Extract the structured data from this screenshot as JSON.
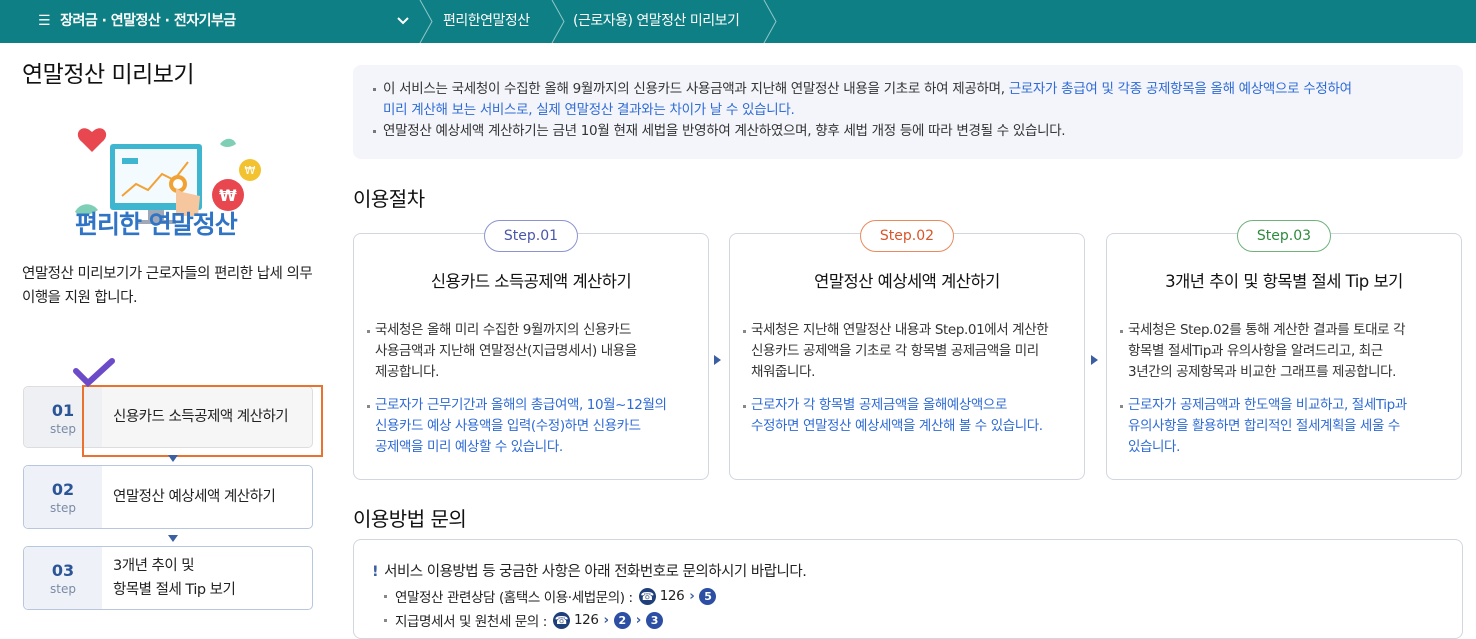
{
  "topbar": {
    "menu_icon": "hamburger-icon",
    "menu_label": "장려금 · 연말정산 · 전자기부금",
    "breadcrumb": [
      "편리한연말정산",
      "(근로자용) 연말정산 미리보기"
    ]
  },
  "sidebar": {
    "title": "연말정산 미리보기",
    "brand": "편리한 연말정산",
    "description": "연말정산 미리보기가 근로자들의  편리한 납세 의무 이행을 지원 합니다.",
    "steps": [
      {
        "num": "01",
        "sub": "step",
        "label": "신용카드 소득공제액 계산하기"
      },
      {
        "num": "02",
        "sub": "step",
        "label": "연말정산 예상세액 계산하기"
      },
      {
        "num": "03",
        "sub": "step",
        "label_line1": "3개년 추이 및",
        "label_line2": "항목별 절세 Tip 보기"
      }
    ]
  },
  "notice": {
    "line1_a": "이 서비스는 국세청이 수집한 올해 9월까지의 신용카드 사용금액과 지난해 연말정산 내용을 기초로 하여 제공하며, ",
    "line1_b": "근로자가 총급여 및 각종 공제항목을 올해 예상액으로 수정하여",
    "line1_c": "미리 계산해 보는 서비스로, 실제 연말정산 결과와는 차이가 날 수 있습니다.",
    "line2": "연말정산 예상세액 계산하기는 금년 10월 현재 세법을 반영하여 계산하였으며, 향후 세법 개정 등에 따라 변경될 수 있습니다."
  },
  "procedure": {
    "heading": "이용절차",
    "cards": [
      {
        "step": "Step.01",
        "title": "신용카드 소득공제액 계산하기",
        "body": [
          "국세청은 올해 미리 수집한 9월까지의 신용카드",
          "사용금액과 지난해 연말정산(지급명세서) 내용을",
          "제공합니다."
        ],
        "note": [
          "근로자가 근무기간과 올해의 총급여액, 10월~12월의",
          "신용카드 예상 사용액을 입력(수정)하면 신용카드",
          "공제액을 미리 예상할 수 있습니다."
        ]
      },
      {
        "step": "Step.02",
        "title": "연말정산 예상세액 계산하기",
        "body": [
          "국세청은 지난해 연말정산 내용과 Step.01에서 계산한",
          "신용카드 공제액을 기초로 각 항목별 공제금액을 미리",
          "채워줍니다."
        ],
        "note": [
          "근로자가 각 항목별 공제금액을 올해예상액으로",
          "수정하면 연말정산 예상세액을 계산해 볼 수 있습니다."
        ]
      },
      {
        "step": "Step.03",
        "title": "3개년 추이 및 항목별 절세 Tip 보기",
        "body": [
          "국세청은 Step.02를 통해 계산한 결과를 토대로 각",
          "항목별 절세Tip과 유의사항을 알려드리고, 최근",
          "3년간의 공제항목과 비교한 그래프를 제공합니다."
        ],
        "note": [
          "근로자가 공제금액과 한도액을 비교하고, 절세Tip과",
          "유의사항을 활용하면 합리적인 절세계획을 세울 수",
          "있습니다."
        ]
      }
    ]
  },
  "inquiry": {
    "heading": "이용방법 문의",
    "intro_mark": "!",
    "intro": "서비스 이용방법 등 궁금한 사항은 아래 전화번호로 문의하시기 바랍니다.",
    "rows": [
      {
        "label": "연말정산 관련상담 (홈택스 이용·세법문의) :",
        "phone": "126",
        "steps": [
          "5"
        ]
      },
      {
        "label": "지급명세서 및 원천세 문의 :",
        "phone": "126",
        "steps": [
          "2",
          "3"
        ]
      }
    ]
  },
  "colors": {
    "topbar": "#0e7f84",
    "step1": "#5b66b8",
    "step2": "#e0662e",
    "step3": "#2e8a3c",
    "link": "#2f6bd5",
    "highlight": "#e8722e"
  }
}
